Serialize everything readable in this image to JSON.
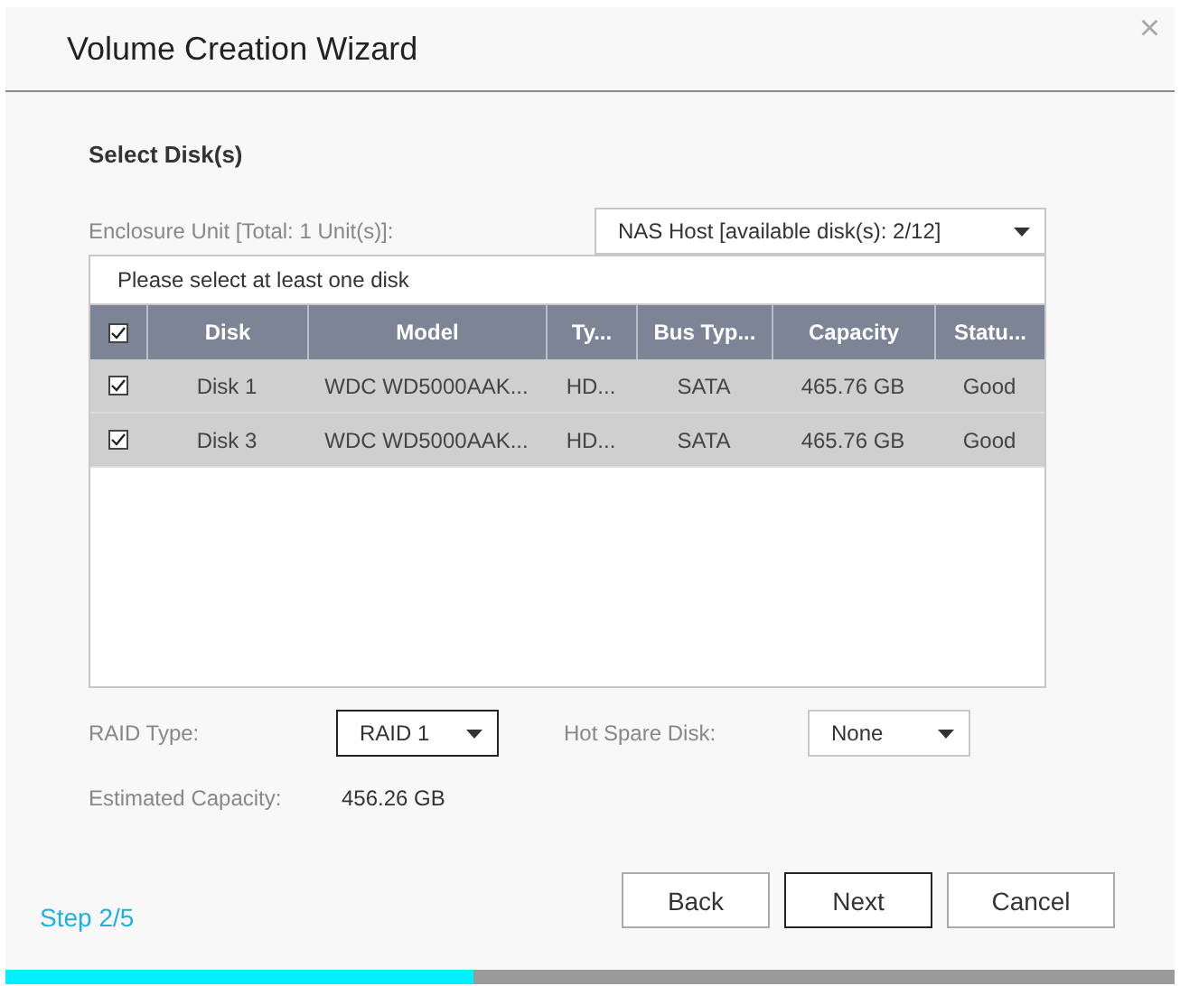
{
  "window": {
    "title": "Volume Creation Wizard",
    "close": "×"
  },
  "section_title": "Select Disk(s)",
  "enclosure": {
    "label": "Enclosure Unit [Total: 1 Unit(s)]:",
    "dropdown": {
      "value": "NAS Host [available disk(s): 2/12]",
      "focused": false
    }
  },
  "table": {
    "hint": "Please select at least one disk",
    "select_all": {
      "checked": true
    },
    "columns": [
      "Disk",
      "Model",
      "Ty...",
      "Bus Typ...",
      "Capacity",
      "Statu..."
    ],
    "rows": [
      {
        "checked": true,
        "selected": true,
        "cells": [
          "Disk 1",
          "WDC WD5000AAK...",
          "HD...",
          "SATA",
          "465.76 GB",
          "Good"
        ]
      },
      {
        "checked": true,
        "selected": true,
        "cells": [
          "Disk 3",
          "WDC WD5000AAK...",
          "HD...",
          "SATA",
          "465.76 GB",
          "Good"
        ]
      }
    ]
  },
  "raid_type": {
    "label": "RAID Type:",
    "dropdown": {
      "value": "RAID 1",
      "focused": true
    }
  },
  "hot_spare": {
    "label": "Hot Spare Disk:",
    "dropdown": {
      "value": "None",
      "focused": false
    }
  },
  "estimated_capacity": {
    "label": "Estimated Capacity:",
    "value": "456.26 GB"
  },
  "step": "Step 2/5",
  "buttons": [
    {
      "label": "Back",
      "focused": false
    },
    {
      "label": "Next",
      "focused": true
    },
    {
      "label": "Cancel",
      "focused": false
    }
  ],
  "progress": {
    "level": 0.4
  }
}
